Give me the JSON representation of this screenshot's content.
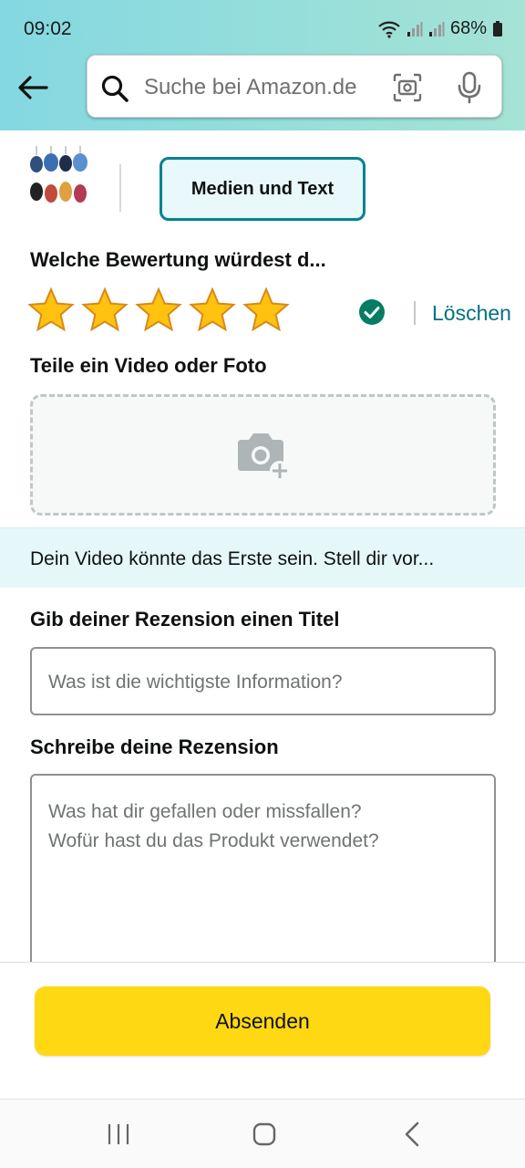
{
  "status_bar": {
    "time": "09:02",
    "battery": "68%"
  },
  "search": {
    "placeholder": "Suche bei Amazon.de"
  },
  "media_tab": {
    "label": "Medien und Text"
  },
  "rating": {
    "heading": "Welche Bewertung würdest d...",
    "stars": 5,
    "max_stars": 5,
    "delete_label": "Löschen"
  },
  "media_upload": {
    "heading": "Teile ein Video oder Foto"
  },
  "banner": {
    "text": "Dein Video könnte das Erste sein. Stell dir vor..."
  },
  "review_title": {
    "heading": "Gib deiner Rezension einen Titel",
    "placeholder": "Was ist die wichtigste Information?"
  },
  "review_body": {
    "heading": "Schreibe deine Rezension",
    "placeholder": "Was hat dir gefallen oder missfallen?\nWofür hast du das Produkt verwendet?"
  },
  "submit": {
    "label": "Absenden"
  },
  "colors": {
    "accent_teal": "#00838f",
    "link": "#007185",
    "submit_yellow": "#ffd814",
    "star_gold": "#ffa41c",
    "check_green": "#067d62"
  },
  "icons": [
    "back-arrow-icon",
    "search-icon",
    "camera-scan-icon",
    "microphone-icon",
    "check-circle-icon",
    "add-photo-icon",
    "recent-apps-icon",
    "home-icon",
    "nav-back-icon"
  ]
}
